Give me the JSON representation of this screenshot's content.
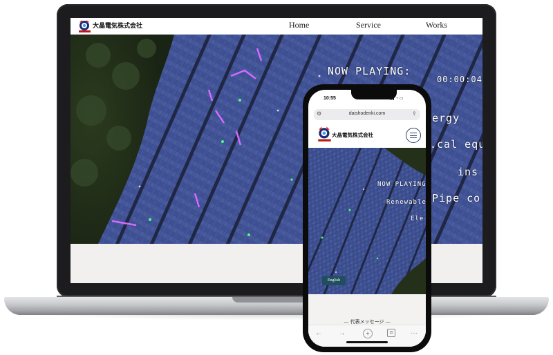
{
  "laptop": {
    "site": {
      "logo_text": "大晶電気株式会社",
      "nav": [
        {
          "label": "Home"
        },
        {
          "label": "Service"
        },
        {
          "label": "Works"
        }
      ]
    },
    "hero_overlay": {
      "now_playing": "NOW PLAYING:",
      "timer": "00:00:04:",
      "line1": "ergy",
      "line2": ".cal equ",
      "line3": "ins",
      "line4": "Pipe co"
    }
  },
  "phone": {
    "status": {
      "time": "10:55"
    },
    "browser": {
      "url": "daishodenki.com"
    },
    "site": {
      "logo_text": "大晶電気株式会社"
    },
    "hero_overlay": {
      "now_playing": "NOW PLAYING",
      "line1": "Renewable",
      "line2": "Ele"
    },
    "english_button": "English",
    "section_title": "— 代表メッセージ —",
    "toolbar": {
      "tabs_count": "15"
    }
  },
  "colors": {
    "device_frame": "#1c1c1e",
    "button_bg": "#1f4f5f",
    "menu_accent": "#2b3e63",
    "panel_blue": "#3a4d8c",
    "highlight_magenta": "#d36bff",
    "highlight_green": "#4dff7a"
  },
  "icons": {
    "logo": "company-emblem-icon",
    "menu": "hamburger-menu-icon",
    "back": "arrow-left-icon",
    "forward": "arrow-right-icon",
    "new_tab": "plus-icon",
    "tabs": "tabs-icon",
    "more": "ellipsis-icon",
    "share": "share-icon",
    "reader": "page-settings-icon"
  }
}
